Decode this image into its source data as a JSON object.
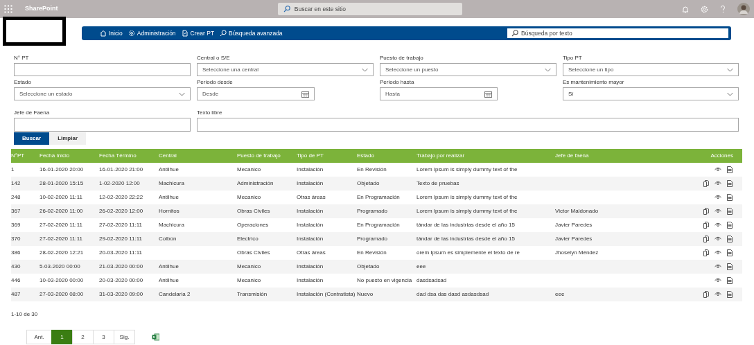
{
  "suite_bar": {
    "app_name": "SharePoint",
    "search_placeholder": "Buscar en este sitio"
  },
  "nav": {
    "items": [
      {
        "label": "Inicio",
        "kind": "home"
      },
      {
        "label": "Administración",
        "kind": "settings"
      },
      {
        "label": "Crear PT",
        "kind": "create"
      },
      {
        "label": "Búsqueda avanzada",
        "kind": "search"
      }
    ],
    "search_placeholder": "Búsqueda por texto"
  },
  "filters": [
    {
      "label": "N° PT",
      "kind": "text"
    },
    {
      "label": "Central o S/E",
      "kind": "select",
      "placeholder": "Seleccione una central"
    },
    {
      "label": "Puesto de trabajo",
      "kind": "select",
      "placeholder": "Seleccione un puesto"
    },
    {
      "label": "Tipo PT",
      "kind": "select",
      "placeholder": "Seleccione un tipo"
    },
    {
      "label": "Estado",
      "kind": "select",
      "placeholder": "Seleccione un estado"
    },
    {
      "label": "Periodo desde",
      "kind": "date",
      "placeholder": "Desde"
    },
    {
      "label": "Periodo hasta",
      "kind": "date",
      "placeholder": "Hasta"
    },
    {
      "label": "Es mantenimiento mayor",
      "kind": "select",
      "value": "Sí"
    },
    {
      "label": "Jefe de Faena",
      "kind": "text"
    },
    {
      "label": "Texto libre",
      "kind": "wide_text"
    }
  ],
  "buttons": [
    {
      "label": "Buscar",
      "kind": "primary"
    },
    {
      "label": "Limpiar",
      "kind": "secondary"
    }
  ],
  "table": {
    "columns": [
      "N°PT",
      "Fecha Inicio",
      "Fecha Término",
      "Central",
      "Puesto de trabajo",
      "Tipo de PT",
      "Estado",
      "Trabajo por realizar",
      "Jefe de faena",
      "Acciones"
    ],
    "rows": [
      {
        "cells": [
          "1",
          "16-01-2020 20:00",
          "16-01-2020 21:00",
          "Antilhue",
          "Mecanico",
          "Instalación",
          "En Revisión",
          "Lorem Ipsum is simply dummy text of the",
          ""
        ],
        "actions": [
          {
            "kind": "view"
          },
          {
            "kind": "pdf"
          }
        ]
      },
      {
        "cells": [
          "142",
          "28-01-2020 15:15",
          "1-02-2020 12:00",
          "Machicura",
          "Administración",
          "Instalación",
          "Objetado",
          "Texto de pruebas",
          ""
        ],
        "actions": [
          {
            "kind": "copy"
          },
          {
            "kind": "view"
          },
          {
            "kind": "pdf"
          }
        ]
      },
      {
        "cells": [
          "248",
          "10-02-2020 11:11",
          "12-02-2020 22:22",
          "Antilhue",
          "Mecanico",
          "Otras áreas",
          "En Programación",
          "Lorem Ipsum is simply dummy text of the",
          ""
        ],
        "actions": [
          {
            "kind": "view"
          },
          {
            "kind": "pdf"
          }
        ]
      },
      {
        "cells": [
          "367",
          "26-02-2020 11:00",
          "26-02-2020 12:00",
          "Hornitos",
          "Obras Civiles",
          "Instalación",
          "Programado",
          "Lorem Ipsum is simply dummy text of the",
          "Victor Maldonado"
        ],
        "actions": [
          {
            "kind": "copy"
          },
          {
            "kind": "view"
          },
          {
            "kind": "pdf"
          }
        ]
      },
      {
        "cells": [
          "369",
          "27-02-2020 11:11",
          "27-02-2020 11:11",
          "Machicura",
          "Operaciones",
          "Instalación",
          "En Programación",
          "tándar de las industrias desde el año 15",
          "Javier Paredes"
        ],
        "actions": [
          {
            "kind": "copy"
          },
          {
            "kind": "view"
          },
          {
            "kind": "pdf"
          }
        ]
      },
      {
        "cells": [
          "370",
          "27-02-2020 11:11",
          "29-02-2020 11:11",
          "Colbún",
          "Electrico",
          "Instalación",
          "Programado",
          "tándar de las industrias desde el año 15",
          "Javier Paredes"
        ],
        "actions": [
          {
            "kind": "copy"
          },
          {
            "kind": "view"
          },
          {
            "kind": "pdf"
          }
        ]
      },
      {
        "cells": [
          "386",
          "28-02-2020 12:21",
          "20-03-2020 11:11",
          "",
          "Obras Civiles",
          "Otras áreas",
          "En Revisión",
          "orem Ipsum es simplemente el texto de re",
          "Jhoselyn Méndez"
        ],
        "actions": [
          {
            "kind": "copy"
          },
          {
            "kind": "view"
          },
          {
            "kind": "pdf"
          }
        ]
      },
      {
        "cells": [
          "430",
          "5-03-2020 00:00",
          "21-03-2020 00:00",
          "Antilhue",
          "Mecanico",
          "Instalación",
          "Objetado",
          "eee",
          ""
        ],
        "actions": [
          {
            "kind": "view"
          },
          {
            "kind": "pdf"
          }
        ]
      },
      {
        "cells": [
          "446",
          "10-03-2020 00:00",
          "20-03-2020 00:00",
          "Antilhue",
          "Mecanico",
          "Instalación",
          "No puesto en vigencia",
          "dasdsadsad",
          ""
        ],
        "actions": [
          {
            "kind": "view"
          },
          {
            "kind": "pdf"
          }
        ]
      },
      {
        "cells": [
          "487",
          "27-03-2020 08:00",
          "31-03-2020 09:00",
          "Candelaria 2",
          "Transmisión",
          "Instalación (Contratista)",
          "Nuevo",
          "dad dsa das dasd asdasdsad",
          "eee"
        ],
        "actions": [
          {
            "kind": "copy"
          },
          {
            "kind": "view"
          },
          {
            "kind": "pdf"
          }
        ]
      }
    ]
  },
  "range_text": "1-10 de 30",
  "pagination": [
    {
      "label": "Ant.",
      "selected": false
    },
    {
      "label": "1",
      "selected": true
    },
    {
      "label": "2",
      "selected": false
    },
    {
      "label": "3",
      "selected": false
    },
    {
      "label": "Sig.",
      "selected": false
    }
  ]
}
